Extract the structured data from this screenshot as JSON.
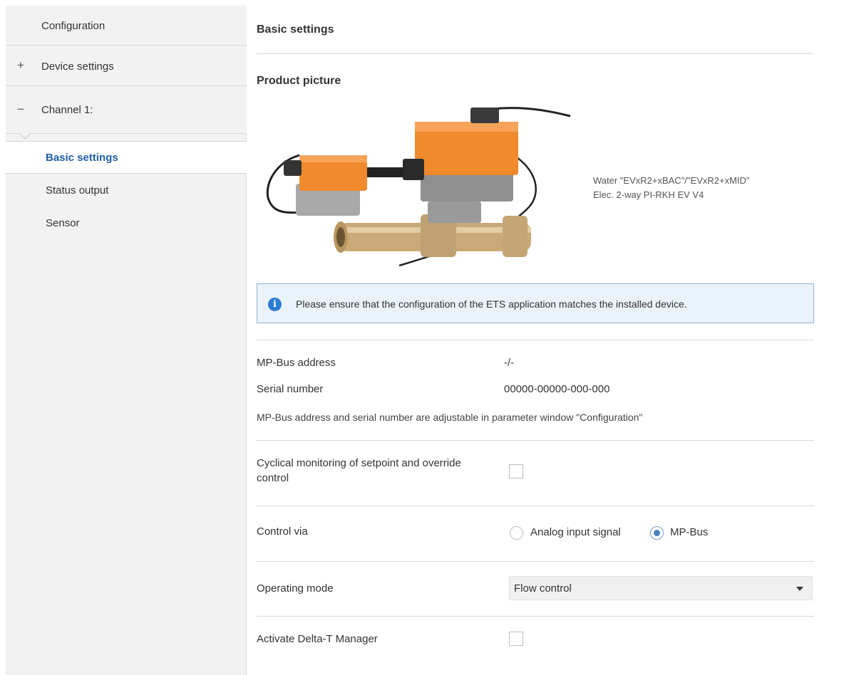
{
  "sidebar": {
    "configuration": "Configuration",
    "device_settings": "Device settings",
    "device_settings_sign": "+",
    "channel": "Channel 1:",
    "channel_sign": "−",
    "items": [
      {
        "label": "Basic settings",
        "active": true
      },
      {
        "label": "Status output",
        "active": false
      },
      {
        "label": "Sensor",
        "active": false
      }
    ]
  },
  "main": {
    "title": "Basic settings",
    "product_picture_title": "Product picture",
    "product_caption_line1": "Water \"EVxR2+xBAC\"/\"EVxR2+xMID\"",
    "product_caption_line2": "Elec. 2-way PI-RKH EV V4",
    "info_icon": "info-icon",
    "info_message": "Please ensure that the configuration of the ETS application matches the installed device.",
    "mpbus_address_label": "MP-Bus address",
    "mpbus_address_value": "-/-",
    "serial_number_label": "Serial number",
    "serial_number_value": "00000-00000-000-000",
    "adjust_note": "MP-Bus address and serial number are adjustable in parameter window \"Configuration\"",
    "cyclical_label_line1": "Cyclical monitoring of setpoint and override",
    "cyclical_label_line2": "control",
    "cyclical_checked": false,
    "control_via_label": "Control via",
    "control_options": [
      "Analog input signal",
      "MP-Bus"
    ],
    "control_selected": "MP-Bus",
    "operating_mode_label": "Operating mode",
    "operating_mode_value": "Flow control",
    "delta_t_label": "Activate Delta-T Manager",
    "delta_t_checked": false
  },
  "colors": {
    "accent": "#1e5fa8",
    "actuator_orange": "#f08a2c",
    "info_background": "#eaf2fa",
    "info_border": "#8fb4d6"
  }
}
